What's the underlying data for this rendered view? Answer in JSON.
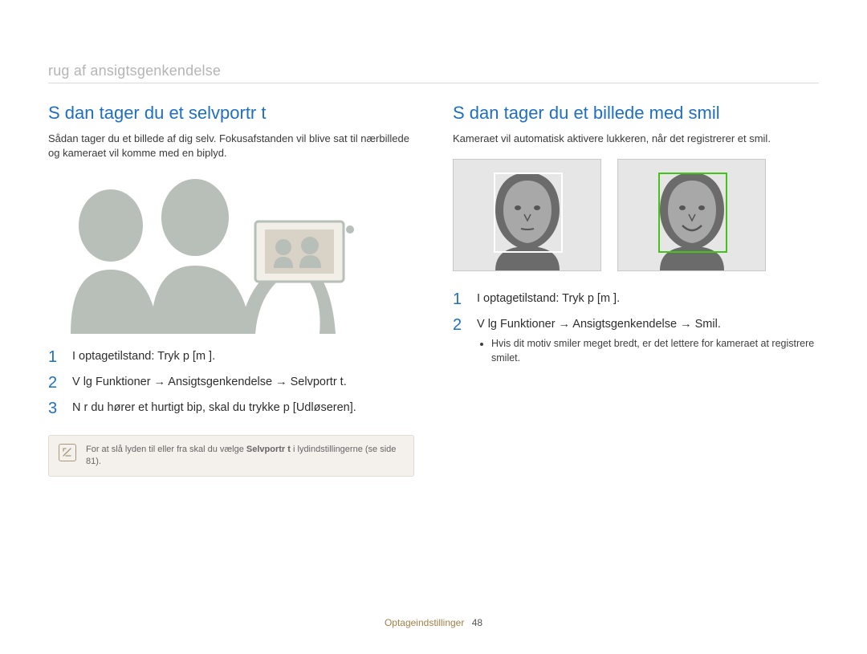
{
  "section_header": "rug af ansigtsgenkendelse",
  "left": {
    "title": "S dan tager du et selvportr t",
    "intro": "Sådan tager du et billede af dig selv. Fokusafstanden vil blive sat til nærbillede og kameraet vil komme med en biplyd.",
    "steps": [
      {
        "num": "1",
        "text": "I optagetilstand: Tryk p  [m      ]."
      },
      {
        "num": "2",
        "text": "V lg  Funktioner → Ansigtsgenkendelse → Selvportr t."
      },
      {
        "num": "3",
        "text": "N r du hører et hurtigt bip, skal du trykke p  [Udløseren]."
      }
    ],
    "note_pre": "For at slå lyden til eller fra skal du vælge ",
    "note_bold": "Selvportr t",
    "note_post": " i lydindstillingerne (se side 81)."
  },
  "right": {
    "title": "S dan tager du et billede med smil",
    "intro": "Kameraet vil automatisk aktivere lukkeren, når det registrerer et smil.",
    "steps": [
      {
        "num": "1",
        "text": "I optagetilstand: Tryk p  [m      ]."
      },
      {
        "num": "2",
        "text": "V lg  Funktioner → Ansigtsgenkendelse → Smil.",
        "bullet": "Hvis dit motiv smiler meget bredt, er det lettere for kameraet at registrere smilet."
      }
    ]
  },
  "footer_label": "Optageindstillinger",
  "footer_page": "48"
}
